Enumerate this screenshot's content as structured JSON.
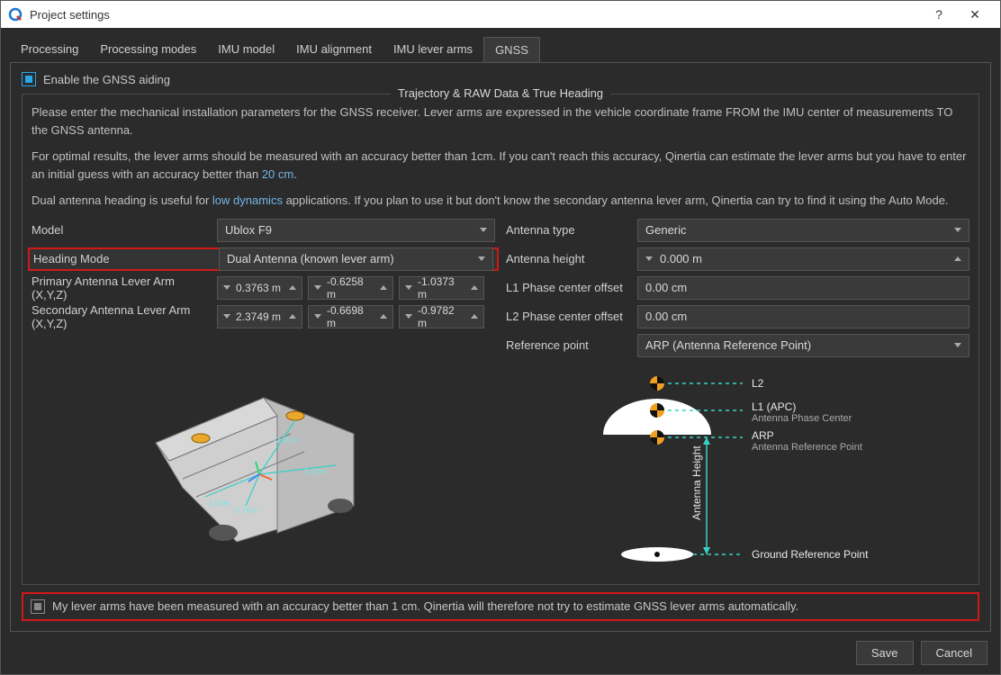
{
  "window": {
    "title": "Project settings"
  },
  "tabs": [
    "Processing",
    "Processing modes",
    "IMU model",
    "IMU alignment",
    "IMU lever arms",
    "GNSS"
  ],
  "active_tab": 5,
  "enable_label": "Enable the GNSS aiding",
  "group_title": "Trajectory & RAW Data & True Heading",
  "desc_line1": "Please enter the mechanical installation parameters for the GNSS receiver. Lever arms are expressed in the vehicle coordinate frame FROM the IMU center of measurements TO the GNSS antenna.",
  "desc_line2a": "For optimal results, the lever arms should be measured with an accuracy better than 1cm. If you can't reach this accuracy, Qinertia can estimate the lever arms but you have to enter an initial guess with an accuracy better than ",
  "desc_line2b": "20 cm",
  "desc_line2c": ".",
  "desc_line3a": "Dual antenna heading is useful for ",
  "desc_line3b": "low dynamics",
  "desc_line3c": " applications. If you plan to use it but don't know the secondary antenna lever arm, Qinertia can try to find it using the Auto Mode.",
  "left": {
    "model_label": "Model",
    "model_value": "Ublox F9",
    "heading_label": "Heading Mode",
    "heading_value": "Dual Antenna (known lever arm)",
    "primary_label": "Primary Antenna Lever Arm (X,Y,Z)",
    "primary_vals": [
      "0.3763 m",
      "-0.6258 m",
      "-1.0373 m"
    ],
    "secondary_label": "Secondary Antenna Lever Arm (X,Y,Z)",
    "secondary_vals": [
      "2.3749 m",
      "-0.6698 m",
      "-0.9782 m"
    ],
    "veh_dims": [
      "-2.00m",
      "2.50m",
      "-2.00m",
      "-0.70m"
    ]
  },
  "right": {
    "antenna_type_label": "Antenna type",
    "antenna_type_value": "Generic",
    "antenna_height_label": "Antenna height",
    "antenna_height_value": "0.000 m",
    "l1_label": "L1 Phase center offset",
    "l1_value": "0.00 cm",
    "l2_label": "L2 Phase center offset",
    "l2_value": "0.00 cm",
    "ref_label": "Reference point",
    "ref_value": "ARP (Antenna Reference Point)",
    "diagram": {
      "l2": "L2",
      "l1": "L1 (APC)",
      "l1_sub": "Antenna Phase Center",
      "arp": "ARP",
      "arp_sub": "Antenna Reference Point",
      "ah": "Antenna Height",
      "grp": "Ground Reference Point"
    }
  },
  "accuracy_label": "My lever arms have been measured with an accuracy better than 1 cm. Qinertia will therefore not try to estimate GNSS lever arms automatically.",
  "buttons": {
    "save": "Save",
    "cancel": "Cancel"
  }
}
